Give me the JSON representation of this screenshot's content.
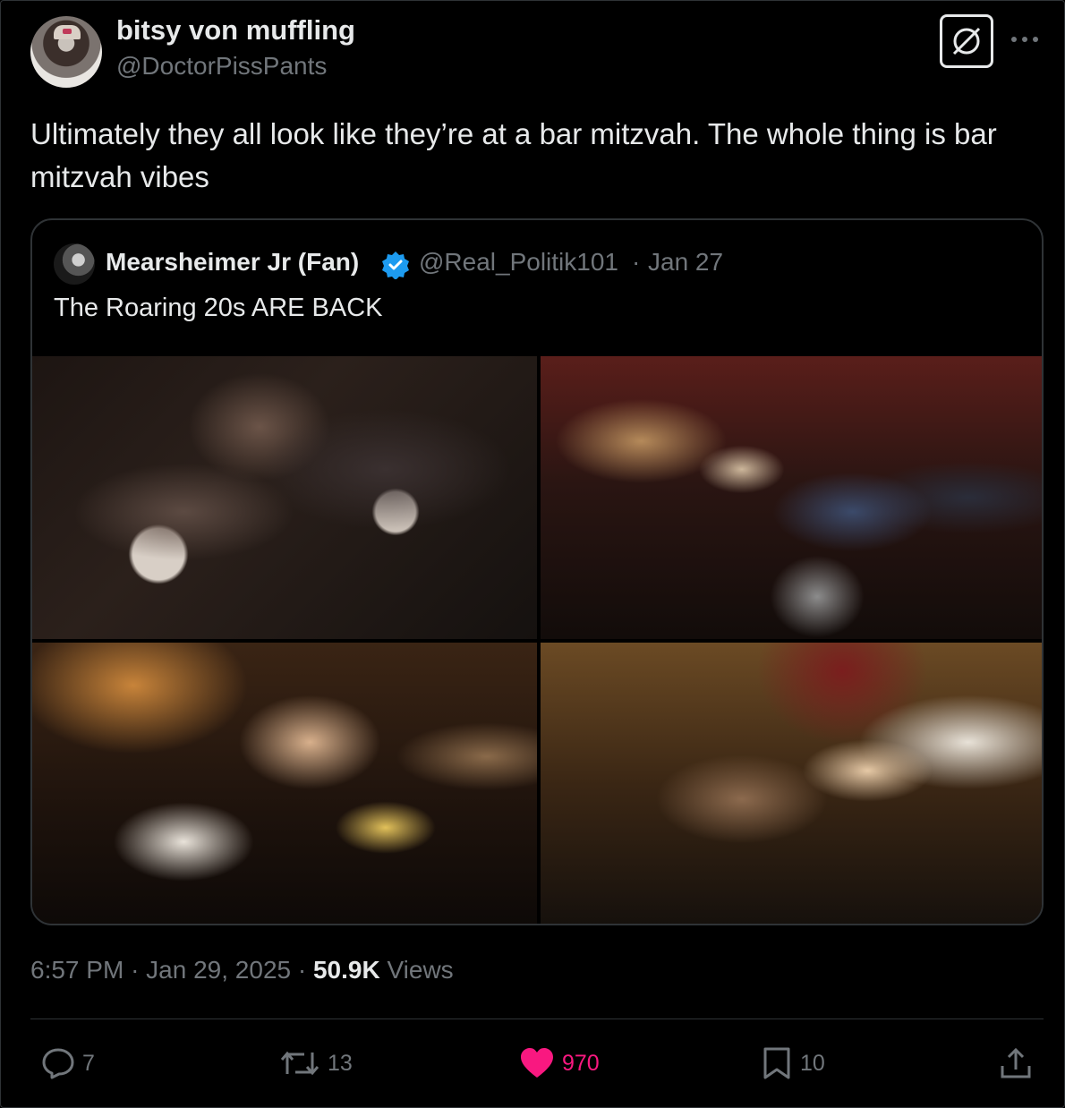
{
  "author": {
    "display_name": "bitsy von muffling",
    "handle": "@DoctorPissPants"
  },
  "tweet": {
    "text": "Ultimately they all look like they’re at a bar mitzvah. The whole thing is bar mitzvah vibes",
    "time": "6:57 PM",
    "date": "Jan 29, 2025",
    "views_count": "50.9K",
    "views_label": "Views",
    "separator": "·"
  },
  "quoted": {
    "display_name": "Mearsheimer Jr (Fan)",
    "handle": "@Real_Politik101",
    "date": "Jan 27",
    "separator": "·",
    "text": "The Roaring 20s ARE BACK",
    "photos": [
      "party-crowd-photo",
      "lounge-photo",
      "selfie-photo",
      "cowboy-hats-photo"
    ]
  },
  "actions": {
    "replies": "7",
    "reposts": "13",
    "likes": "970",
    "bookmarks": "10"
  },
  "colors": {
    "background": "#000000",
    "text_primary": "#e7e9ea",
    "text_secondary": "#71767b",
    "border": "#2f3336",
    "like": "#f91880",
    "verified": "#1d9bf0"
  },
  "icons": {
    "grok": "grok-icon",
    "more": "more-icon",
    "reply": "reply-icon",
    "repost": "repost-icon",
    "like": "heart-filled-icon",
    "bookmark": "bookmark-icon",
    "share": "share-icon",
    "verified": "verified-badge-icon"
  }
}
